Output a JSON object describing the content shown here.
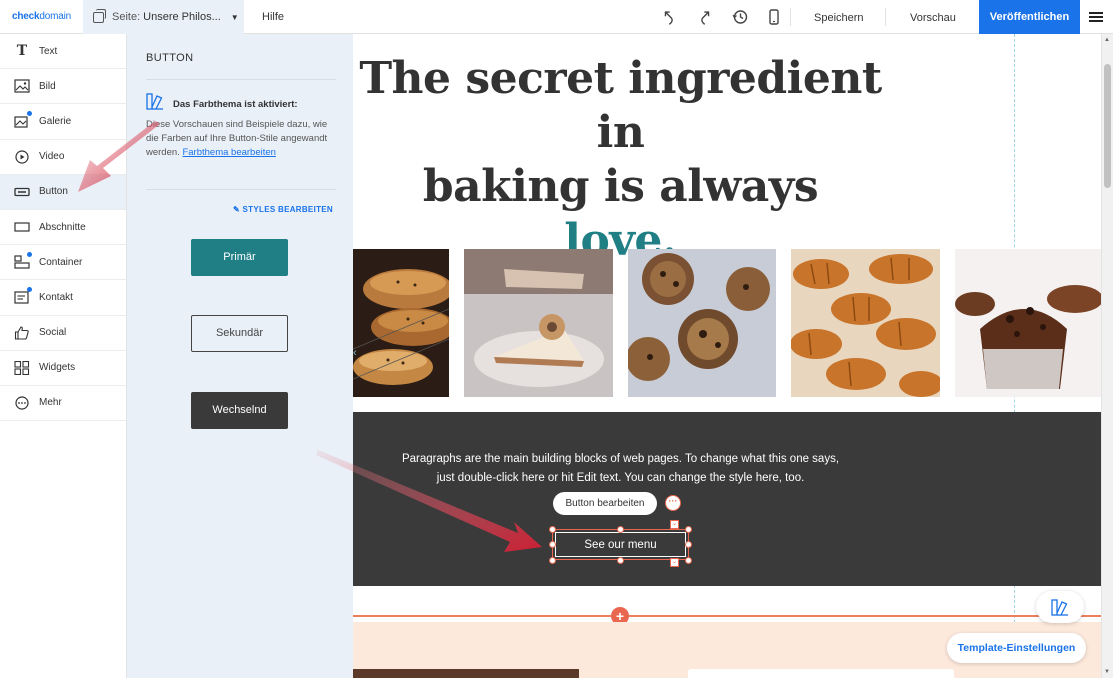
{
  "app": {
    "brand_left": "check",
    "brand_right": "domain"
  },
  "topbar": {
    "page_label": "Seite:",
    "page_name": "Unsere Philos...",
    "help": "Hilfe",
    "save": "Speichern",
    "preview": "Vorschau",
    "publish": "Veröffentlichen"
  },
  "sidebar": {
    "items": [
      {
        "label": "Text",
        "icon": "text-icon"
      },
      {
        "label": "Bild",
        "icon": "image-icon"
      },
      {
        "label": "Galerie",
        "icon": "gallery-icon"
      },
      {
        "label": "Video",
        "icon": "video-icon"
      },
      {
        "label": "Button",
        "icon": "button-icon"
      },
      {
        "label": "Abschnitte",
        "icon": "section-icon"
      },
      {
        "label": "Container",
        "icon": "container-icon"
      },
      {
        "label": "Kontakt",
        "icon": "contact-icon"
      },
      {
        "label": "Social",
        "icon": "thumbs-up-icon"
      },
      {
        "label": "Widgets",
        "icon": "widgets-icon"
      },
      {
        "label": "Mehr",
        "icon": "more-icon"
      }
    ],
    "active": "Button"
  },
  "panel": {
    "title": "BUTTON",
    "theme_heading": "Das Farbthema ist aktiviert:",
    "theme_desc": "Diese Vorschauen sind Beispiele dazu, wie die Farben auf Ihre Button-Stile angewandt werden.",
    "theme_link": "Farbthema bearbeiten",
    "styles_edit": "STYLES BEARBEITEN",
    "buttons": {
      "primary": "Primär",
      "secondary": "Sekundär",
      "alternate": "Wechselnd"
    }
  },
  "canvas": {
    "hero_line1": "The secret ingredient in",
    "hero_line2": "baking is always",
    "hero_accent": "love.",
    "paragraph_line1": "Paragraphs are the main building blocks of web pages. To change what this one says,",
    "paragraph_line2": "just double-click here or hit Edit text. You can change the style here, too.",
    "edit_button": "Button bearbeiten",
    "cta": "See our menu"
  },
  "floating": {
    "template_settings": "Template-Einstellungen"
  },
  "colors": {
    "accent": "#1f7f85",
    "brand_blue": "#1a73e8",
    "panel_bg": "#e9f0f8",
    "dark_section": "#3a3a3a",
    "selection": "#e8674e",
    "arrow": "#cc1f33"
  }
}
